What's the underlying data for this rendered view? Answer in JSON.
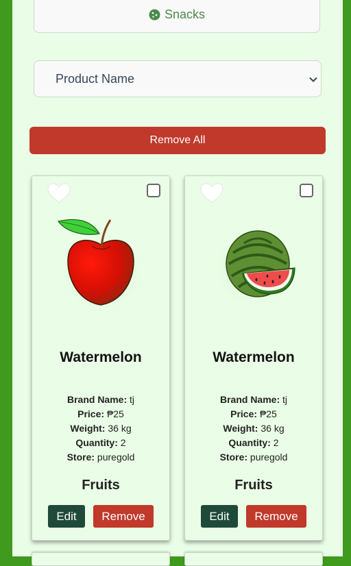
{
  "filter": {
    "category_label": "Snacks",
    "category_icon": "cookie-icon",
    "sort_selected": "Product Name"
  },
  "actions": {
    "remove_all_label": "Remove All"
  },
  "products": [
    {
      "image": "apple-icon",
      "name": "Watermelon",
      "brand_label": "Brand Name:",
      "brand": "tj",
      "price_label": "Price:",
      "price": "₱25",
      "weight_label": "Weight:",
      "weight": "36 kg",
      "quantity_label": "Quantity:",
      "quantity": "2",
      "store_label": "Store:",
      "store": "puregold",
      "category": "Fruits",
      "edit_label": "Edit",
      "remove_label": "Remove"
    },
    {
      "image": "watermelon-icon",
      "name": "Watermelon",
      "brand_label": "Brand Name:",
      "brand": "tj",
      "price_label": "Price:",
      "price": "₱25",
      "weight_label": "Weight:",
      "weight": "36 kg",
      "quantity_label": "Quantity:",
      "quantity": "2",
      "store_label": "Store:",
      "store": "puregold",
      "category": "Fruits",
      "edit_label": "Edit",
      "remove_label": "Remove"
    }
  ],
  "colors": {
    "frame_green": "#3f9a1e",
    "panel_bg": "#eafde6",
    "danger_red": "#c0392b",
    "edit_dark_green": "#1f4a39"
  }
}
